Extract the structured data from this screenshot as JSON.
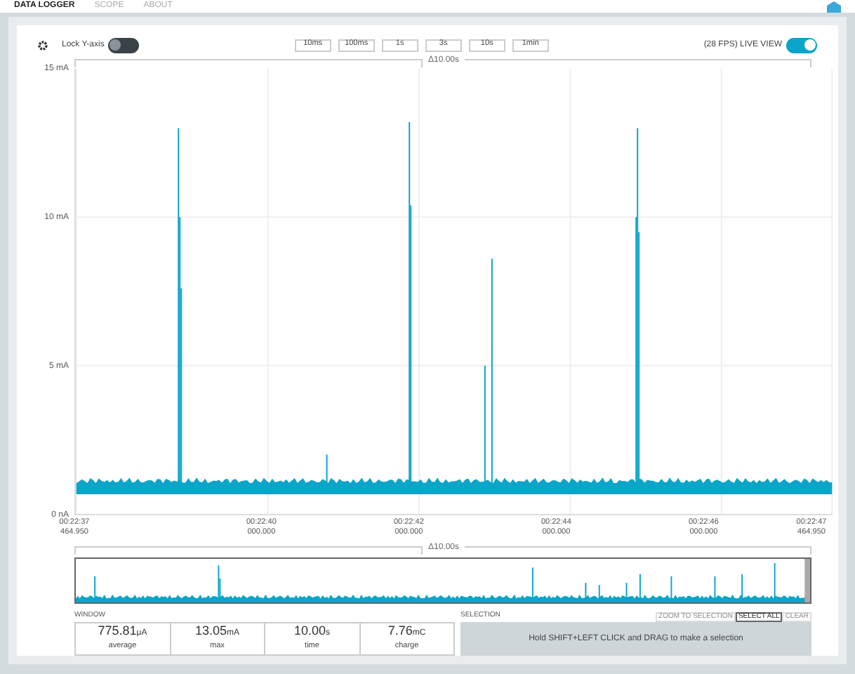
{
  "nav": {
    "tabs": [
      {
        "label": "DATA LOGGER",
        "selected": true
      },
      {
        "label": "SCOPE",
        "selected": false
      },
      {
        "label": "ABOUT",
        "selected": false
      }
    ]
  },
  "toolbar": {
    "lock_y_axis": {
      "label": "Lock Y-axis",
      "on": false
    },
    "window_buttons": [
      "10ms",
      "100ms",
      "1s",
      "3s",
      "10s",
      "1min"
    ],
    "live_view": {
      "label": "(28 FPS) LIVE VIEW",
      "on": true
    }
  },
  "chart": {
    "span_label": "Δ10.00s",
    "y_ticks": [
      "15 mA",
      "10 mA",
      "5 mA",
      "0 nA"
    ],
    "x_ticks": [
      {
        "time": "00:22:37",
        "sub": "464.950"
      },
      {
        "time": "00:22:40",
        "sub": "000.000"
      },
      {
        "time": "00:22:42",
        "sub": "000.000"
      },
      {
        "time": "00:22:44",
        "sub": "000.000"
      },
      {
        "time": "00:22:46",
        "sub": "000.000"
      },
      {
        "time": "00:22:47",
        "sub": "464.950"
      }
    ]
  },
  "overview": {
    "span_label": "Δ10.00s"
  },
  "window_stats": {
    "title": "WINDOW",
    "items": [
      {
        "value": "775.81",
        "unit": "μA",
        "label": "average"
      },
      {
        "value": "13.05",
        "unit": "mA",
        "label": "max"
      },
      {
        "value": "10.00",
        "unit": "s",
        "label": "time"
      },
      {
        "value": "7.76",
        "unit": "mC",
        "label": "charge"
      }
    ]
  },
  "selection": {
    "title": "SELECTION",
    "buttons": [
      {
        "label": "ZOOM TO SELECTION",
        "disabled": true
      },
      {
        "label": "SELECT ALL",
        "disabled": false
      },
      {
        "label": "CLEAR",
        "disabled": true
      }
    ],
    "message": "Hold SHIFT+LEFT CLICK and DRAG to make a selection"
  }
}
